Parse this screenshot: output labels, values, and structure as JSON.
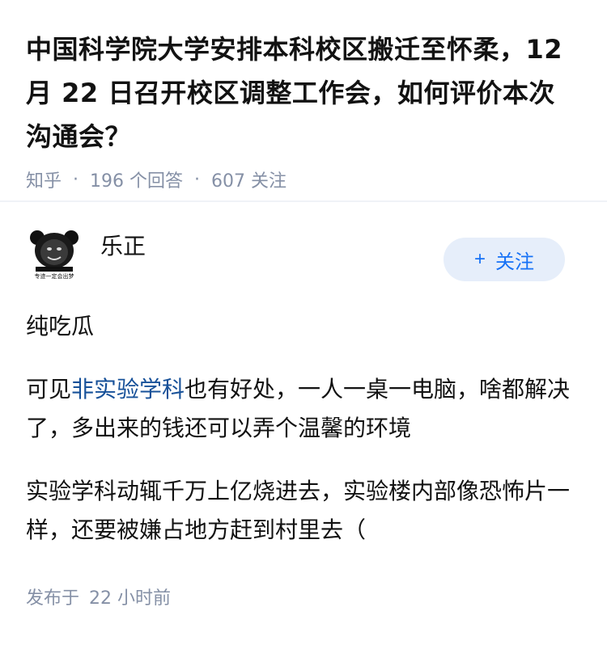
{
  "question": {
    "title": "中国科学院大学安排本科校区搬迁至怀柔，12 月 22 日召开校区调整工作会，如何评价本次沟通会？",
    "source": "知乎",
    "answers_count": "196 个回答",
    "followers_count": "607 关注"
  },
  "answer": {
    "author_name": "乐正",
    "avatar_caption": "专迹一定会出梦",
    "follow_label": "关注",
    "paragraphs": {
      "p1": "纯吃瓜",
      "p2_link": "非实验学科",
      "p2_before": "可见",
      "p2_after": "也有好处，一人一桌一电脑，啥都解决了，多出来的钱还可以弄个温馨的环境",
      "p3": "实验学科动辄千万上亿烧进去，实验楼内部像恐怖片一样，还要被嫌占地方赶到村里去（"
    },
    "published_label": "发布于",
    "published_time": "22 小时前"
  },
  "colors": {
    "accent": "#1772f6",
    "link": "#175199",
    "meta_gray": "#8590a6",
    "follow_bg": "#e6eefa"
  }
}
